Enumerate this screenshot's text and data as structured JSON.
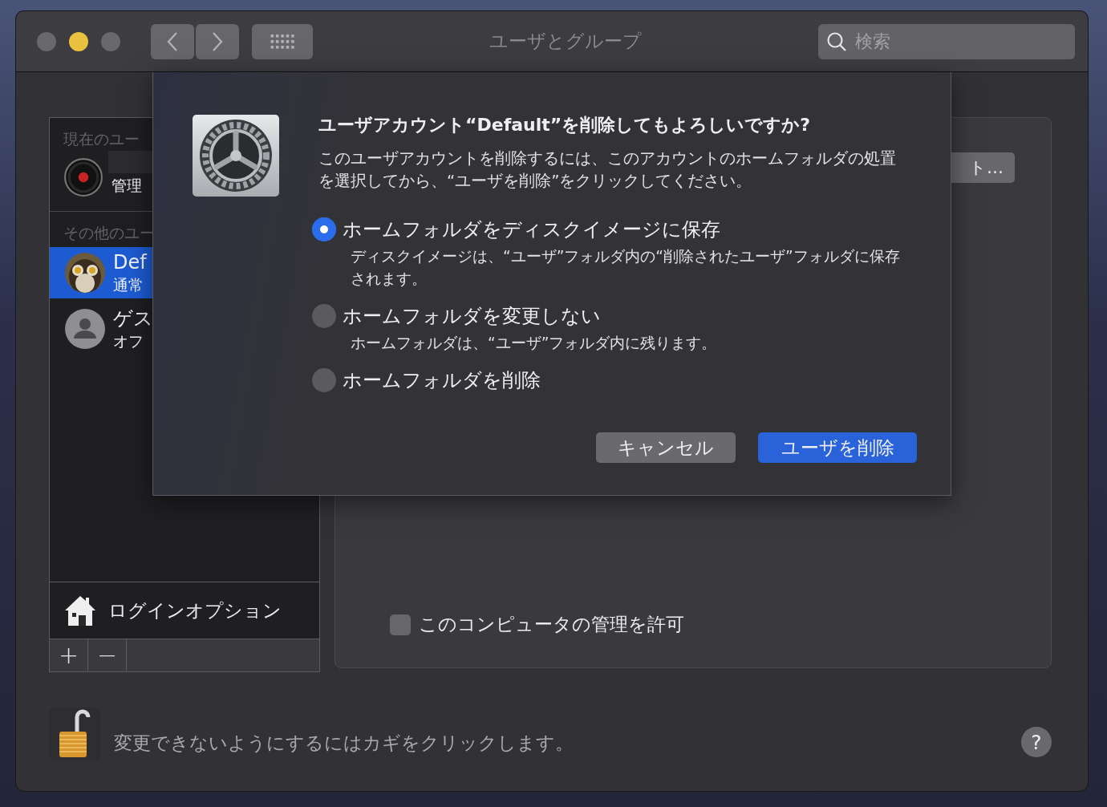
{
  "window": {
    "title": "ユーザとグループ"
  },
  "toolbar": {
    "search": {
      "placeholder": "検索"
    }
  },
  "sidebar": {
    "sections": [
      {
        "header": "現在のユー",
        "users": [
          {
            "kind": "record",
            "redacted": true,
            "role": "管理",
            "selected": false
          }
        ]
      },
      {
        "header": "その他のユー",
        "users": [
          {
            "name": "Def",
            "role": "通常",
            "selected": true
          },
          {
            "kind": "guest",
            "name": "ゲス",
            "role": "オフ",
            "selected": false
          }
        ]
      }
    ],
    "login_options": "ログインオプション",
    "list_buttons": [
      "+",
      "−"
    ]
  },
  "panel": {
    "button": "ト…",
    "checkbox": {
      "label": "このコンピュータの管理を許可",
      "checked": false
    }
  },
  "footer": {
    "lock_text": "変更できないようにするにはカギをクリックします。",
    "help": "?"
  },
  "dialog": {
    "title": "ユーザアカウント“Default”を削除してもよろしいですか?",
    "message": "このユーザアカウントを削除するには、このアカウントのホームフォルダの処置を選択してから、“ユーザを削除”をクリックしてください。",
    "options": [
      {
        "label": "ホームフォルダをディスクイメージに保存",
        "note": "ディスクイメージは、“ユーザ”フォルダ内の“削除されたユーザ”フォルダに保存されます。",
        "selected": true
      },
      {
        "label": "ホームフォルダを変更しない",
        "note": "ホームフォルダは、“ユーザ”フォルダ内に残ります。",
        "selected": false
      },
      {
        "label": "ホームフォルダを削除",
        "selected": false
      }
    ],
    "buttons": [
      {
        "label": "キャンセル",
        "kind": "secondary"
      },
      {
        "label": "ユーザを削除",
        "kind": "primary"
      }
    ]
  }
}
